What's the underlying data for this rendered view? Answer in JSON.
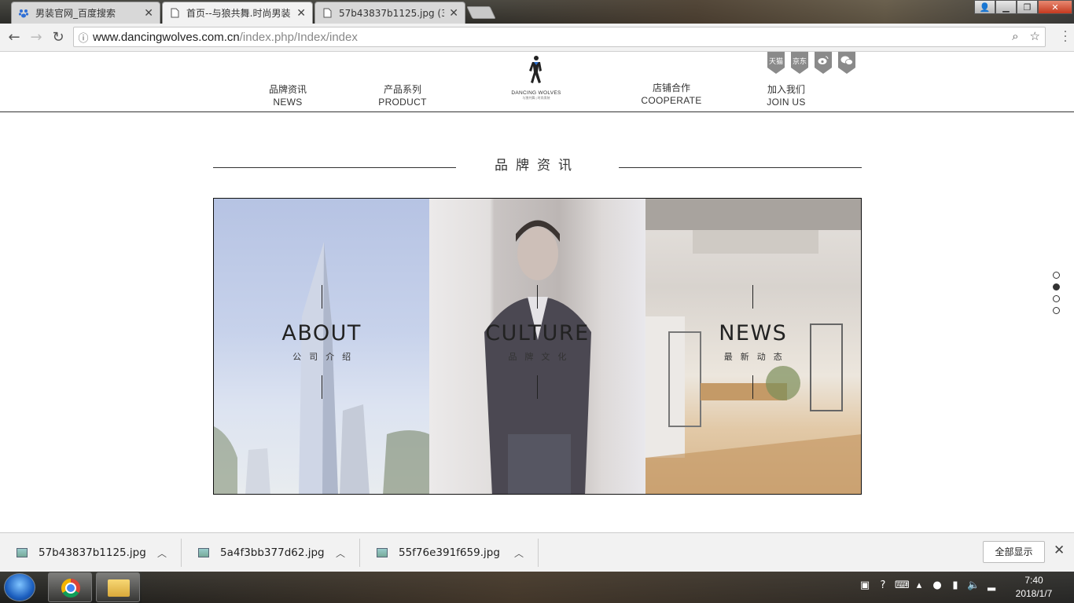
{
  "browser": {
    "tabs": [
      {
        "title": "男装官网_百度搜索",
        "active": false
      },
      {
        "title": "首页--与狼共舞.时尚男装",
        "active": true
      },
      {
        "title": "57b43837b1125.jpg (3",
        "active": false
      }
    ],
    "url_host": "www.dancingwolves.com.cn",
    "url_path": "/index.php/Index/index"
  },
  "site": {
    "nav": [
      {
        "cn": "品牌资讯",
        "en": "NEWS"
      },
      {
        "cn": "产品系列",
        "en": "PRODUCT"
      },
      {
        "cn": "店铺合作",
        "en": "COOPERATE"
      },
      {
        "cn": "加入我们",
        "en": "JOIN US"
      }
    ],
    "logo": {
      "name": "DANCING WOLVES",
      "sub": "与狼共舞 | 时尚男装"
    },
    "social": [
      {
        "label": "天猫",
        "icon": "tmall-icon"
      },
      {
        "label": "京东",
        "icon": "jd-icon"
      },
      {
        "label": "",
        "icon": "weibo-icon"
      },
      {
        "label": "",
        "icon": "wechat-icon"
      }
    ],
    "section_title": "品牌资讯",
    "panels": [
      {
        "title": "ABOUT",
        "sub": "公司介绍"
      },
      {
        "title": "CULTURE",
        "sub": "品牌文化"
      },
      {
        "title": "NEWS",
        "sub": "最新动态"
      }
    ],
    "dots_active_index": 1
  },
  "downloads": {
    "items": [
      {
        "name": "57b43837b1125.jpg"
      },
      {
        "name": "5a4f3bb377d62.jpg"
      },
      {
        "name": "55f76e391f659.jpg"
      }
    ],
    "show_all": "全部显示"
  },
  "taskbar": {
    "time": "7:40",
    "date": "2018/1/7"
  }
}
